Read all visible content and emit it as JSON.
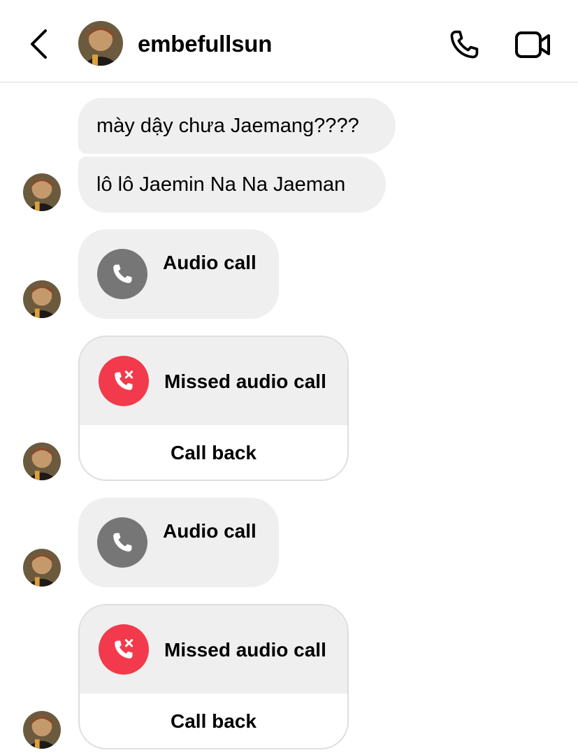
{
  "header": {
    "username": "embefullsun",
    "back_icon": "chevron-left-icon",
    "phone_icon": "phone-icon",
    "video_icon": "video-camera-icon"
  },
  "messages": [
    {
      "type": "text",
      "text": "mày dậy chưa Jaemang????"
    },
    {
      "type": "text",
      "text": "lô lô Jaemin Na Na Jaeman"
    },
    {
      "type": "call",
      "title": "Audio call",
      "icon": "phone-icon"
    },
    {
      "type": "missed_call",
      "title": "Missed audio call",
      "action": "Call back",
      "icon": "missed-call-icon"
    },
    {
      "type": "call",
      "title": "Audio call",
      "icon": "phone-icon"
    },
    {
      "type": "missed_call",
      "title": "Missed audio call",
      "action": "Call back",
      "icon": "missed-call-icon"
    }
  ],
  "colors": {
    "bubble": "#efefef",
    "call_icon_bg": "#767676",
    "missed_icon_bg": "#f23a4c",
    "divider": "#dbdbdb"
  }
}
